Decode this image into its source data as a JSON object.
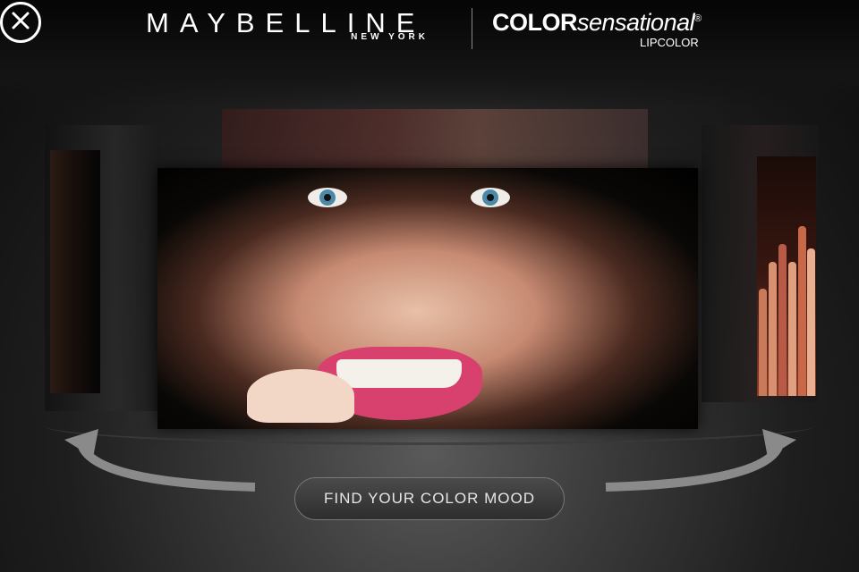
{
  "header": {
    "brand": "MAYBELLINE",
    "brand_sub": "NEW YORK",
    "product_bold": "COLOR",
    "product_light": "sensational",
    "product_mark": "®",
    "product_sub": "LIPCOLOR"
  },
  "carousel": {
    "panels": [
      "lipsticks-panel",
      "model-face-panel",
      "lipstick-lineup-panel"
    ]
  },
  "cta": {
    "label": "FIND YOUR COLOR MOOD"
  },
  "icons": {
    "close": "close-icon",
    "rotate_left": "rotate-left-arrow-icon",
    "rotate_right": "rotate-right-arrow-icon"
  },
  "colors": {
    "accent_lip": "#d8406e",
    "button_border": "#777777",
    "text": "#ffffff"
  }
}
